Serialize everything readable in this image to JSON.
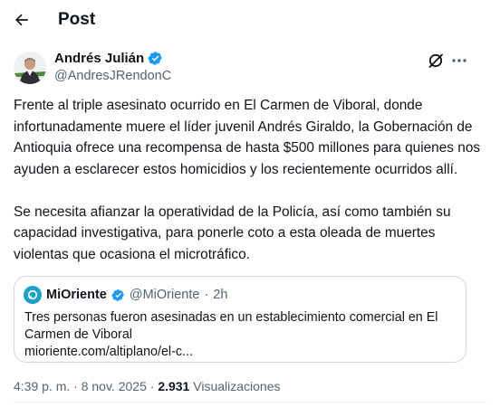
{
  "header": {
    "title": "Post",
    "back_icon": "arrow-left-icon"
  },
  "author": {
    "name": "Andrés Julián",
    "handle": "@AndresJRendonC",
    "verified_color": "#1d9bf0"
  },
  "tweet": {
    "paragraphs": [
      "Frente al triple asesinato ocurrido en El Carmen de Viboral, donde infortunadamente muere el líder juvenil Andrés Giraldo, la Gobernación de Antioquia ofrece una recompensa de hasta $500 millones para quienes nos ayuden a esclarecer estos homicidios y los recientemente ocurridos allí.",
      "Se necesita afianzar la operatividad de la Policía, así como también su capacidad investigativa, para ponerle coto a esta oleada de muertes violentas que ocasiona el microtráfico."
    ]
  },
  "quote": {
    "name": "MiOriente",
    "handle": "@MiOriente",
    "dot": "·",
    "time": "2h",
    "text": "Tres personas fueron asesinadas en un establecimiento comercial en El Carmen de Viboral",
    "link": "mioriente.com/altiplano/el-c..."
  },
  "meta": {
    "time": "4:39 p. m.",
    "sep": "·",
    "date": "8 nov. 2025",
    "views_count": "2.931",
    "views_label": "Visualizaciones"
  },
  "colors": {
    "text": "#0f1419",
    "muted": "#536471",
    "border": "#cfd9de",
    "accent": "#1d9bf0"
  }
}
